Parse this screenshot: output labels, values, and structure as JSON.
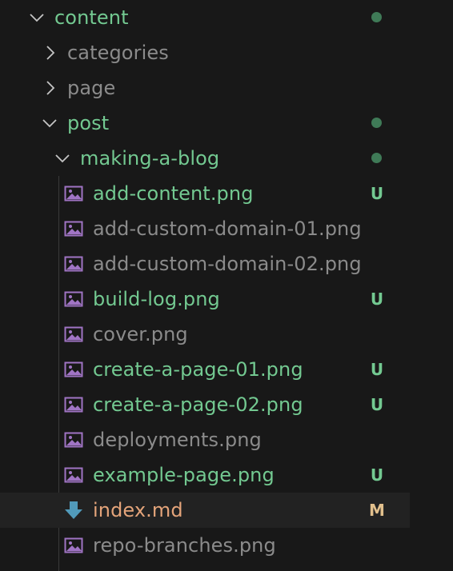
{
  "colors": {
    "untracked": "#73c991",
    "ignored": "#8b8b8b",
    "modified": "#e2c08d",
    "modified_text": "#e4a47a",
    "image_icon": "#a074c4",
    "markdown_icon": "#519aba",
    "dot": "#3f7a57"
  },
  "tree": {
    "folders": {
      "content": "content",
      "categories": "categories",
      "page": "page",
      "post": "post",
      "making_a_blog": "making-a-blog"
    },
    "files": [
      {
        "name": "add-content.png",
        "status": "U",
        "icon": "image-icon"
      },
      {
        "name": "add-custom-domain-01.png",
        "status": "",
        "icon": "image-icon"
      },
      {
        "name": "add-custom-domain-02.png",
        "status": "",
        "icon": "image-icon"
      },
      {
        "name": "build-log.png",
        "status": "U",
        "icon": "image-icon"
      },
      {
        "name": "cover.png",
        "status": "",
        "icon": "image-icon"
      },
      {
        "name": "create-a-page-01.png",
        "status": "U",
        "icon": "image-icon"
      },
      {
        "name": "create-a-page-02.png",
        "status": "U",
        "icon": "image-icon"
      },
      {
        "name": "deployments.png",
        "status": "",
        "icon": "image-icon"
      },
      {
        "name": "example-page.png",
        "status": "U",
        "icon": "image-icon"
      },
      {
        "name": "index.md",
        "status": "M",
        "icon": "markdown-download-icon"
      },
      {
        "name": "repo-branches.png",
        "status": "",
        "icon": "image-icon"
      }
    ]
  }
}
